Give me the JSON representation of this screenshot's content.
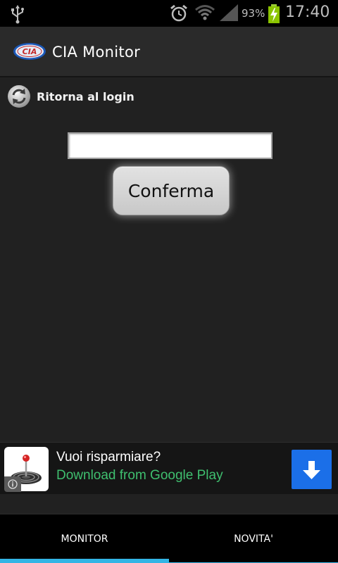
{
  "status_bar": {
    "battery_percent": "93%",
    "time": "17:40",
    "icons": [
      "usb-icon",
      "alarm-icon",
      "wifi-icon",
      "signal-icon",
      "battery-icon"
    ]
  },
  "action_bar": {
    "title": "CIA Monitor",
    "logo_text": "CIA"
  },
  "return_link": {
    "label": "Ritorna al login",
    "icon": "refresh-icon"
  },
  "form": {
    "input_value": "",
    "confirm_label": "Conferma"
  },
  "ad": {
    "headline": "Vuoi risparmiare?",
    "subline": "Download from Google Play",
    "icon": "joystick-icon",
    "button_icon": "download-icon"
  },
  "tabs": [
    {
      "label": "MONITOR",
      "selected": true
    },
    {
      "label": "NOVITA'",
      "selected": false
    }
  ],
  "colors": {
    "background": "#212121",
    "accent": "#33b5e5",
    "ad_green": "#3fbf6f",
    "download_blue": "#1b6fe8"
  }
}
